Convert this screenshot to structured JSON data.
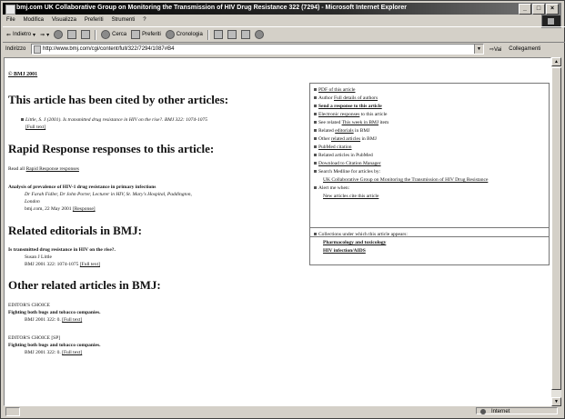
{
  "window": {
    "title": "bmj.com UK Collaborative Group on Monitoring the Transmission of HIV Drug Resistance 322 (7294) - Microsoft Internet Explorer",
    "min": "_",
    "max": "□",
    "close": "×"
  },
  "menu": [
    "File",
    "Modifica",
    "Visualizza",
    "Preferiti",
    "Strumenti",
    "?"
  ],
  "toolbar": {
    "back": "Indietro",
    "forward": "⇒",
    "stop": "",
    "search": "Cerca",
    "favorites": "Preferiti",
    "history": "Cronologia"
  },
  "address": {
    "label": "Indirizzo",
    "url": "http://www.bmj.com/cgi/content/full/322/7294/1087#B4",
    "go": "Vai",
    "links": "Collegamenti"
  },
  "page": {
    "copyright": "© BMJ 2001",
    "cited_heading": "This article has been cited by other articles:",
    "cited_item": "Little, S. J (2001). Is transmitted drug resistance in HIV on the rise?. BMJ 322: 1074-1075",
    "cited_link": "[Full text]",
    "rapid_heading": "Rapid Response responses to this article:",
    "rapid_read": "Read all",
    "rapid_read_link": "Rapid Response responses",
    "analysis_title": "Analysis of prevalence of HIV-1 drug resistance in primary infections",
    "analysis_authors": "Dr Farah Fidler, Dr John Porter, Lecturer in HIV, St. Mary's Hospital, Paddington,",
    "analysis_place": "London",
    "analysis_date": "bmj.com, 22 May 2001",
    "analysis_link": "[Response]",
    "editorials_heading": "Related editorials in BMJ:",
    "editorial_title": "Is transmitted drug resistance in HIV on the rise?.",
    "editorial_author": "Susan J Little",
    "editorial_ref": "BMJ 2001 322: 1074-1075",
    "editorial_link": "[Full text]",
    "other_heading": "Other related articles in BMJ:",
    "other1_tag": "EDITOR'S CHOICE",
    "other1_title": "Fighting both bugs and tobacco companies.",
    "other1_ref": "BMJ 2001 322: 0.",
    "other1_link": "[Full text]",
    "other2_tag": "EDITOR'S CHOICE [SP]",
    "other2_title": "Fighting both bugs and tobacco companies.",
    "other2_ref": "BMJ 2001 322: 0.",
    "other2_link": "[Full text]"
  },
  "sidebar": {
    "items": [
      {
        "pre": "",
        "link": "PDF of this article",
        "post": "",
        "bold": false
      },
      {
        "pre": "Author ",
        "link": "Full details of authors",
        "post": "",
        "bold": false
      },
      {
        "pre": "",
        "link": "Send a response to this article",
        "post": "",
        "bold": true
      },
      {
        "pre": "",
        "link": "Electronic responses",
        "post": " to this article",
        "bold": false
      },
      {
        "pre": "See related ",
        "link": "This week in BMJ",
        "post": " item",
        "bold": false
      },
      {
        "pre": "Related ",
        "link": "editorials",
        "post": " in BMJ",
        "bold": false
      },
      {
        "pre": "Other ",
        "link": "related articles",
        "post": " in BMJ",
        "bold": false
      },
      {
        "pre": "",
        "link": "PubMed citation",
        "post": "",
        "bold": false
      },
      {
        "pre": "Related articles in PubMed",
        "link": "",
        "post": "",
        "bold": false
      },
      {
        "pre": "",
        "link": "Download to Citation Manager",
        "post": "",
        "bold": false
      },
      {
        "pre": "Search Medline for articles by:",
        "link": "",
        "post": "",
        "bold": false
      },
      {
        "pre": "",
        "link": "UK Collaborative Group on Monitoring the Transmission of HIV Drug Resistance",
        "post": "",
        "bold": false
      },
      {
        "pre": "Alert me when:",
        "link": "",
        "post": "",
        "bold": false
      },
      {
        "pre": "",
        "link": "New articles cite this article",
        "post": "",
        "bold": false
      }
    ],
    "collections_intro": "Collections under which this article appears:",
    "collection1": "Pharmacology and toxicology",
    "collection2": "HIV infection/AIDS"
  },
  "status": {
    "zone": "Internet"
  }
}
